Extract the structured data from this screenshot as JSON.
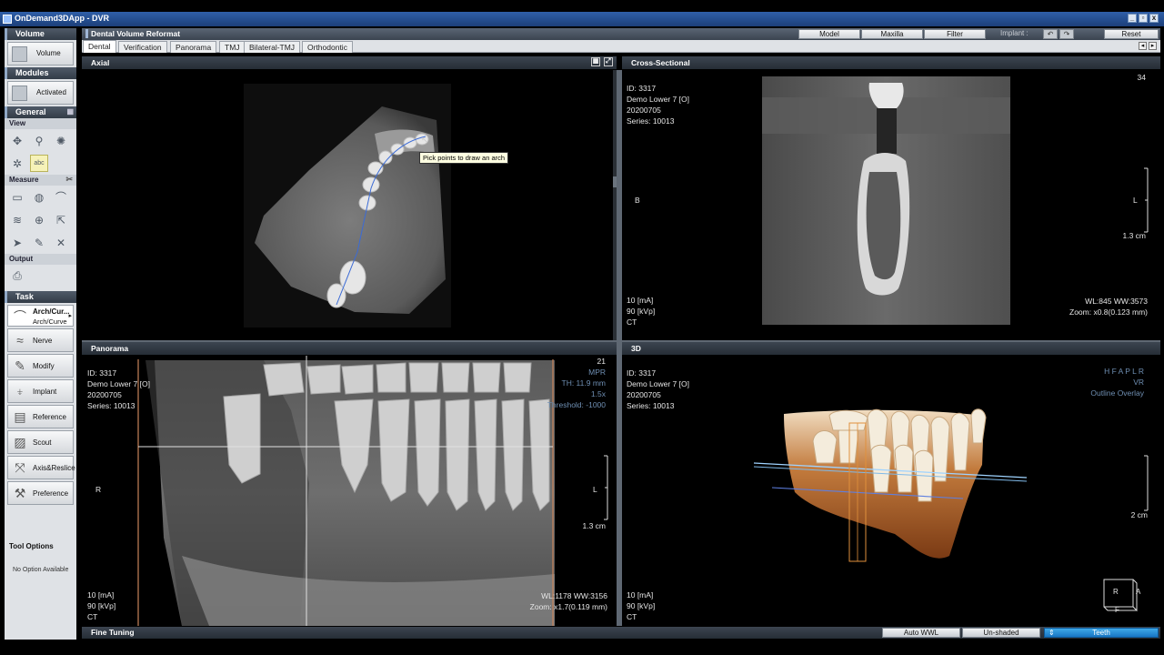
{
  "window": {
    "title": "OnDemand3DApp - DVR"
  },
  "left_panel": {
    "volume": {
      "header": "Volume",
      "button": "Volume"
    },
    "modules": {
      "header": "Modules",
      "button": "Activated"
    },
    "general": {
      "header": "General",
      "view_label": "View",
      "measure_label": "Measure",
      "output_label": "Output"
    },
    "task": {
      "header": "Task",
      "active": {
        "label": "Arch/Cur...",
        "sub": "Arch/Curve"
      },
      "items": [
        "Nerve",
        "Modify",
        "Implant",
        "Reference",
        "Scout",
        "Axis&Reslice",
        "Preference"
      ]
    },
    "tool_options": {
      "header": "Tool Options",
      "text": "No Option Available"
    }
  },
  "toolbar": {
    "title": "Dental Volume Reformat",
    "model": "Model",
    "maxilla": "Maxilla",
    "filter": "Filter",
    "implant_label": "Implant :",
    "reset": "Reset"
  },
  "tabs": [
    "Dental",
    "Verification",
    "Panorama",
    "TMJ",
    "Bilateral-TMJ",
    "Orthodontic"
  ],
  "viewports": {
    "axial": {
      "title": "Axial",
      "tooltip": "Pick points to draw an arch"
    },
    "cross": {
      "title": "Cross-Sectional",
      "slice": "34",
      "id": "ID: 3317",
      "name": "Demo Lower 7 [O]",
      "date": "20200705",
      "series": "Series: 10013",
      "side": "B",
      "side_r": "L",
      "scale": "1.3 cm",
      "ma": "10 [mA]",
      "kvp": "90 [kVp]",
      "modality": "CT",
      "wlww": "WL:845 WW:3573",
      "zoom": "Zoom: x0.8(0.123 mm)"
    },
    "panorama": {
      "title": "Panorama",
      "id": "ID: 3317",
      "name": "Demo Lower 7 [O]",
      "date": "20200705",
      "series": "Series: 10013",
      "slice": "21",
      "mode": "MPR",
      "th": "TH: 11.9 mm",
      "zoomfac": "1.5x",
      "threshold": "Threshold: -1000",
      "side_l": "R",
      "side_r": "L",
      "scale": "1.3 cm",
      "ma": "10 [mA]",
      "kvp": "90 [kVp]",
      "modality": "CT",
      "wlww": "WL:1178 WW:3156",
      "zoom": "Zoom: x1.7(0.119 mm)"
    },
    "three_d": {
      "title": "3D",
      "id": "ID: 3317",
      "name": "Demo Lower 7 [O]",
      "date": "20200705",
      "series": "Series: 10013",
      "orient": "H F A P L R",
      "vr": "VR",
      "outline": "Outline Overlay",
      "scale": "2 cm",
      "ma": "10 [mA]",
      "kvp": "90 [kVp]",
      "modality": "CT",
      "cube_r": "R",
      "cube_a": "A",
      "cube_f": "F"
    }
  },
  "bottom": {
    "title": "Fine Tuning",
    "auto_wwl": "Auto WWL",
    "unshaded": "Un-shaded",
    "teeth": "Teeth"
  }
}
